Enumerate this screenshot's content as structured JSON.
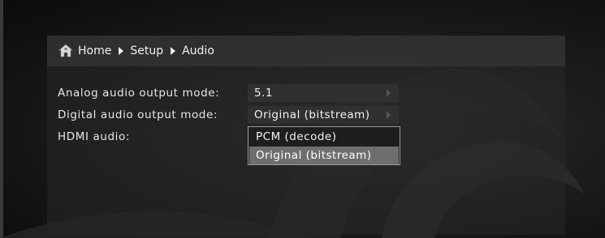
{
  "breadcrumb": {
    "home": "Home",
    "setup": "Setup",
    "audio": "Audio"
  },
  "settings": [
    {
      "label": "Analog audio output mode:",
      "value": "5.1"
    },
    {
      "label": "Digital audio output mode:",
      "value": "Original (bitstream)"
    },
    {
      "label": "HDMI audio:",
      "value": ""
    }
  ],
  "hdmi_dropdown": {
    "options": [
      "PCM (decode)",
      "Original (bitstream)"
    ],
    "selected_index": 1
  },
  "icons": {
    "home": "home-icon",
    "breadcrumb_separator": "triangle-right-icon",
    "value_arrow": "triangle-right-icon"
  },
  "colors": {
    "background": "#161616",
    "highlight": "#6e6e6e",
    "value_box": "#303030"
  }
}
